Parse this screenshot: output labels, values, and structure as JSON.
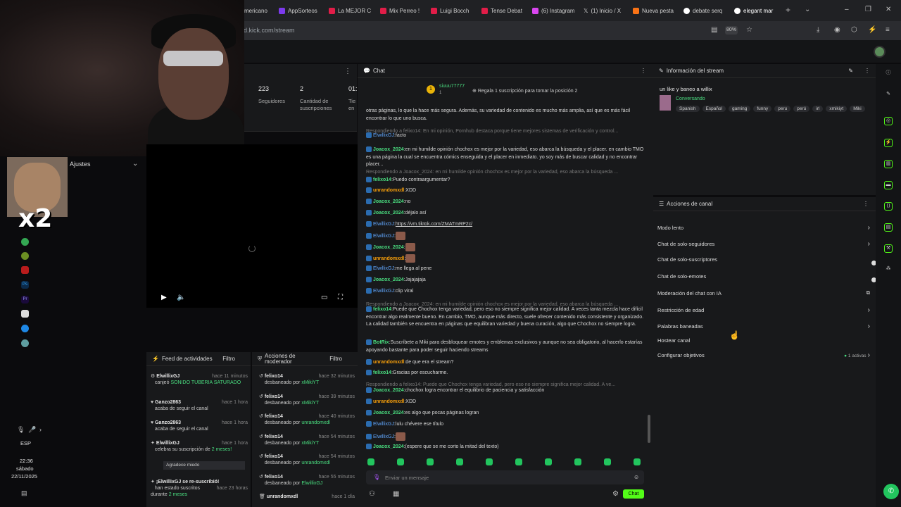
{
  "browser": {
    "tabs": [
      "mericano",
      "AppSorteos",
      "La MEJOR C",
      "Mix Perreo !",
      "Luigi Bocch",
      "Tense Debat",
      "(6) Instagram",
      "(1) Inicio / X",
      "Nueva pesta",
      "debate serq",
      "elegant mar"
    ],
    "url": "d.kick.com/stream",
    "zoom": "80%"
  },
  "stats": {
    "followers_value": "223",
    "followers_label": "Seguidores",
    "subs_value": "2",
    "subs_label": "Cantidad de suscripciones",
    "third_value": "01:",
    "third_label": "Tie en"
  },
  "meme": {
    "overlay": "x2"
  },
  "ajustes": "Ajustes",
  "feed": {
    "title": "Feed de actividades",
    "filter": "Filtro",
    "items": [
      {
        "user": "ElwillixGJ",
        "time": "hace 11 minutos",
        "text": "canjeó",
        "highlight": "SONIDO TUBERIA SATURADO"
      },
      {
        "user": "Ganzo2863",
        "time": "hace 1 hora",
        "text": "acaba de seguir el canal"
      },
      {
        "user": "Ganzo2863",
        "time": "hace 1 hora",
        "text": "acaba de seguir el canal"
      },
      {
        "user": "ElwillixGJ",
        "time": "hace 1 hora",
        "text": "celebra su suscripción de",
        "highlight": "2 meses!",
        "button": "Agradece miedo"
      },
      {
        "user": "¡ElwillixGJ se re-suscribió!",
        "time": "hace 23 horas",
        "text": "han estado suscritos durante",
        "highlight": "2 meses"
      }
    ]
  },
  "mods": {
    "title": "Acciones de moderador",
    "filter": "Filtro",
    "items": [
      {
        "user": "felixo14",
        "time": "hace 32 minutos",
        "by": "xMikiYT"
      },
      {
        "user": "felixo14",
        "time": "hace 39 minutos",
        "by": "xMikiYT"
      },
      {
        "user": "felixo14",
        "time": "hace 40 minutos",
        "by": "unrandomxdl"
      },
      {
        "user": "felixo14",
        "time": "hace 54 minutos",
        "by": "xMikiYT"
      },
      {
        "user": "felixo14",
        "time": "hace 54 minutos",
        "by": "unrandomxdl"
      },
      {
        "user": "felixo14",
        "time": "hace 55 minutos",
        "by": "ElwillixGJ"
      },
      {
        "user": "unrandomxdl",
        "time": "hace 1 día",
        "by": ""
      }
    ],
    "action": "desbaneado por"
  },
  "chat": {
    "title": "Chat",
    "pinned_user": "siuuu77777",
    "pinned_sub": "1",
    "gift_text": "Regala 1 suscripción para tomar la posición 2",
    "lines": [
      {
        "type": "text",
        "text": "otras páginas, lo que la hace más segura. Además, su variedad de contenido es mucho más amplia, así que es más fácil encontrar lo que uno busca."
      },
      {
        "type": "reply",
        "text": "Respondiendo a felixo14: En mi opinión, Pornhub destaca porque tiene mejores sistemas de verificación y control..."
      },
      {
        "type": "msg",
        "user": "ElwillixGJ",
        "color": "b",
        "text": "facto"
      },
      {
        "type": "msg",
        "user": "Joacox_2024",
        "color": "g",
        "text": "en mi humilde opinión chochox es mejor por la variedad, eso abarca la búsqueda y el placer. en cambio TMO es una página la cual se encuentra cómics enseguida y el placer en inmediato. yo soy más de buscar calidad y no encontrar placer..."
      },
      {
        "type": "reply",
        "text": "Respondiendo a Joacox_2024: en mi humilde opinión chochox es mejor por la variedad, eso abarca la búsqueda ..."
      },
      {
        "type": "msg",
        "user": "felixo14",
        "color": "g",
        "text": "Puedo contraargumentar?"
      },
      {
        "type": "msg",
        "user": "unrandomxdl",
        "color": "o",
        "text": "XDD"
      },
      {
        "type": "msg",
        "user": "Joacox_2024",
        "color": "g",
        "text": "no"
      },
      {
        "type": "msg",
        "user": "Joacox_2024",
        "color": "g",
        "text": "déjalo así"
      },
      {
        "type": "msg",
        "user": "ElwillixGJ",
        "color": "b",
        "text": "https://vm.tiktok.com/ZMATmRP2c/"
      },
      {
        "type": "msg",
        "user": "ElwillixGJ",
        "color": "b",
        "text": ""
      },
      {
        "type": "msg",
        "user": "Joacox_2024",
        "color": "g",
        "text": ""
      },
      {
        "type": "msg",
        "user": "unrandomxdl",
        "color": "o",
        "text": ""
      },
      {
        "type": "msg",
        "user": "ElwillixGJ",
        "color": "b",
        "text": "me llega al pene"
      },
      {
        "type": "msg",
        "user": "Joacox_2024",
        "color": "g",
        "text": "Jajajajaja"
      },
      {
        "type": "msg",
        "user": "ElwillixGJ",
        "color": "b",
        "text": "clip viral"
      },
      {
        "type": "reply",
        "text": "Respondiendo a Joacox_2024: en mi humilde opinión chochox es mejor por la variedad, eso abarca la búsqueda ..."
      },
      {
        "type": "msg",
        "user": "felixo14",
        "color": "g",
        "text": "Puede que Chochox tenga variedad, pero eso no siempre significa mejor calidad. A veces tanta mezcla hace difícil encontrar algo realmente bueno. En cambio, TMO, aunque más directo, suele ofrecer contenido más consistente y organizado. La calidad también se encuentra en páginas que equilibran variedad y buena curación, algo que Chochox no siempre logra."
      },
      {
        "type": "msg",
        "user": "BotRix",
        "color": "g",
        "text": "Suscríbete a Miki para desbloquear emotes y emblemas exclusivos y aunque no sea obligatorio, al hacerlo estarías apoyando bastante para poder seguir haciendo streams"
      },
      {
        "type": "msg",
        "user": "unrandomxdl",
        "color": "o",
        "text": "de que era el stream?"
      },
      {
        "type": "msg",
        "user": "felixo14",
        "color": "g",
        "text": "Gracias por escucharme."
      },
      {
        "type": "reply",
        "text": "Respondiendo a felixo14: Puede que Chochox tenga variedad, pero eso no siempre significa mejor calidad. A ve..."
      },
      {
        "type": "msg",
        "user": "Joacox_2024",
        "color": "g",
        "text": "chochox logra encontrar el equilibrio de paciencia y satisfacción"
      },
      {
        "type": "msg",
        "user": "unrandomxdl",
        "color": "o",
        "text": "XDD"
      },
      {
        "type": "msg",
        "user": "Joacox_2024",
        "color": "g",
        "text": "es algo que pocas páginas logran"
      },
      {
        "type": "msg",
        "user": "ElwillixGJ",
        "color": "b",
        "text": "lulu chévere ese título"
      },
      {
        "type": "msg",
        "user": "ElwillixGJ",
        "color": "b",
        "text": ""
      },
      {
        "type": "msg",
        "user": "Joacox_2024",
        "color": "g",
        "text": "(espere que se me corto la mitad del texto)"
      }
    ],
    "input_placeholder": "Enviar un mensaje",
    "send": "Chat"
  },
  "info": {
    "title": "Información del stream",
    "stream_title": "un like y baneo a willix",
    "category": "Conversando",
    "tags": [
      "Spanish",
      "Español",
      "gaming",
      "funny",
      "peru",
      "perú",
      "irl",
      "xmikiyt",
      "Miki"
    ]
  },
  "actions": {
    "title": "Acciones de canal",
    "items": [
      {
        "label": "Modo lento",
        "kind": "arrow"
      },
      {
        "label": "Chat de solo-seguidores",
        "kind": "arrow"
      },
      {
        "label": "Chat de solo-suscriptores",
        "kind": "toggle"
      },
      {
        "label": "Chat de solo-emotes",
        "kind": "toggle"
      },
      {
        "label": "Moderación del chat con IA",
        "kind": "ext"
      },
      {
        "label": "Restricción de edad",
        "kind": "arrow"
      },
      {
        "label": "Palabras baneadas",
        "kind": "arrow"
      },
      {
        "label": "Hostear canal",
        "kind": "none"
      },
      {
        "label": "Configurar objetivos",
        "kind": "arrow",
        "extra": "1 activas"
      }
    ]
  },
  "tray": {
    "lang": "ESP",
    "time": "22:36",
    "day": "sábado",
    "date": "22/11/2025"
  }
}
